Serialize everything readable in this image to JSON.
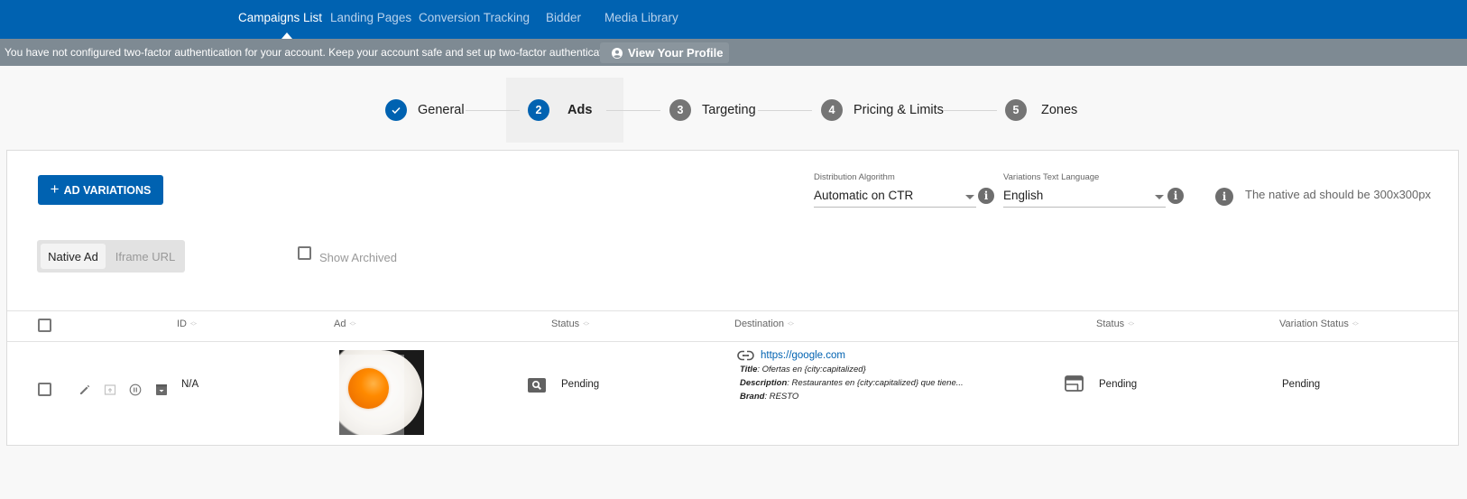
{
  "topnav": {
    "items": [
      {
        "label": "Campaigns List",
        "active": true
      },
      {
        "label": "Landing Pages",
        "active": false
      },
      {
        "label": "Conversion Tracking",
        "active": false
      },
      {
        "label": "Bidder",
        "active": false
      },
      {
        "label": "Media Library",
        "active": false
      }
    ]
  },
  "warning": {
    "message": "You have not configured two-factor authentication for your account. Keep your account safe and set up two-factor authentication now.",
    "button_label": "View Your Profile",
    "button_icon": "user-circle-icon"
  },
  "stepper": {
    "steps": [
      {
        "number": "✓",
        "label": "General",
        "state": "completed"
      },
      {
        "number": "2",
        "label": "Ads",
        "state": "active"
      },
      {
        "number": "3",
        "label": "Targeting",
        "state": "pending"
      },
      {
        "number": "4",
        "label": "Pricing & Limits",
        "state": "pending"
      },
      {
        "number": "5",
        "label": "Zones",
        "state": "pending"
      }
    ]
  },
  "toolbar": {
    "add_button_icon": "+",
    "add_button_label": "AD VARIATIONS",
    "distribution": {
      "label": "Distribution Algorithm",
      "value": "Automatic on CTR"
    },
    "language": {
      "label": "Variations Text Language",
      "value": "English"
    },
    "info_glyph": "i",
    "native_note": "The native ad should be 300x300px",
    "ad_type_options": [
      {
        "label": "Native Ad",
        "selected": true
      },
      {
        "label": "Iframe URL",
        "selected": false
      }
    ],
    "show_archived_label": "Show Archived",
    "show_archived_checked": false
  },
  "table": {
    "columns": [
      "ID",
      "Ad",
      "Status",
      "Destination",
      "Status",
      "Variation Status"
    ],
    "rows": [
      {
        "id": "N/A",
        "ad_image": "fried-egg-thumbnail",
        "status": "Pending",
        "destination": {
          "url": "https://google.com",
          "title_label": "Title",
          "title": "Ofertas en {city:capitalized}",
          "description_label": "Description",
          "description": "Restaurantes en {city:capitalized} que tiene...",
          "brand_label": "Brand",
          "brand": "RESTO"
        },
        "dest_status": "Pending",
        "variation_status": "Pending"
      }
    ]
  },
  "colors": {
    "brand_blue": "#0062b1",
    "warning_bar": "#7e8a93",
    "step_pending": "#757575"
  }
}
